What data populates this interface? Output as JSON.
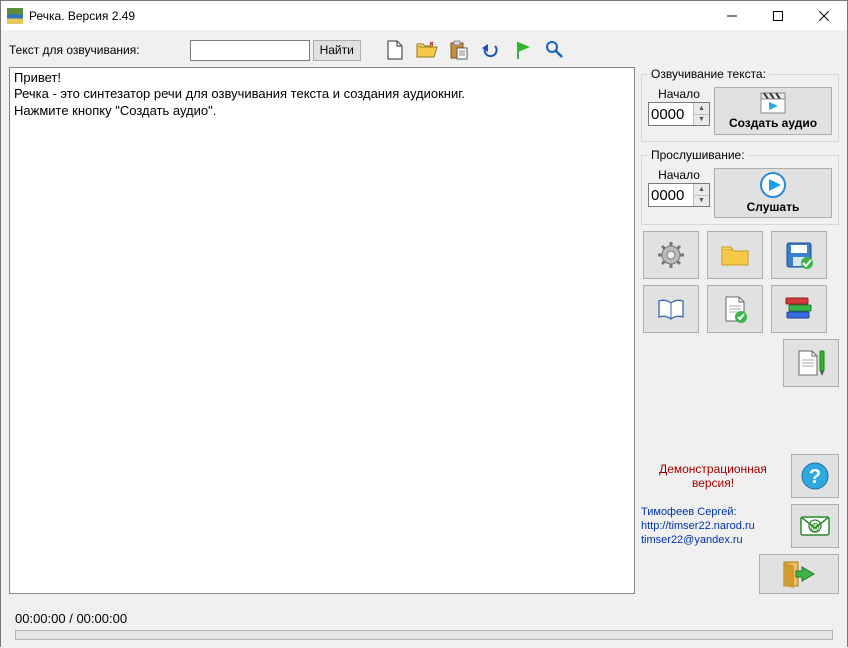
{
  "window": {
    "title": "Речка. Версия 2.49"
  },
  "toolbar": {
    "search_label": "Текст для озвучивания:",
    "search_value": "",
    "find_label": "Найти"
  },
  "textarea": {
    "content": "Привет!\nРечка - это синтезатор речи для озвучивания текста и создания аудиокниг.\nНажмите кнопку \"Создать аудио\"."
  },
  "tts_group": {
    "legend": "Озвучивание текста:",
    "start_label": "Начало",
    "start_value": "0000",
    "button_label": "Создать аудио"
  },
  "listen_group": {
    "legend": "Прослушивание:",
    "start_label": "Начало",
    "start_value": "0000",
    "button_label": "Слушать"
  },
  "demo": {
    "line1": "Демонстрационная",
    "line2": "версия!"
  },
  "author": {
    "name": "Тимофеев Сергей:",
    "url": "http://timser22.narod.ru",
    "email": "timser22@yandex.ru"
  },
  "status": {
    "time": "00:00:00 / 00:00:00"
  }
}
